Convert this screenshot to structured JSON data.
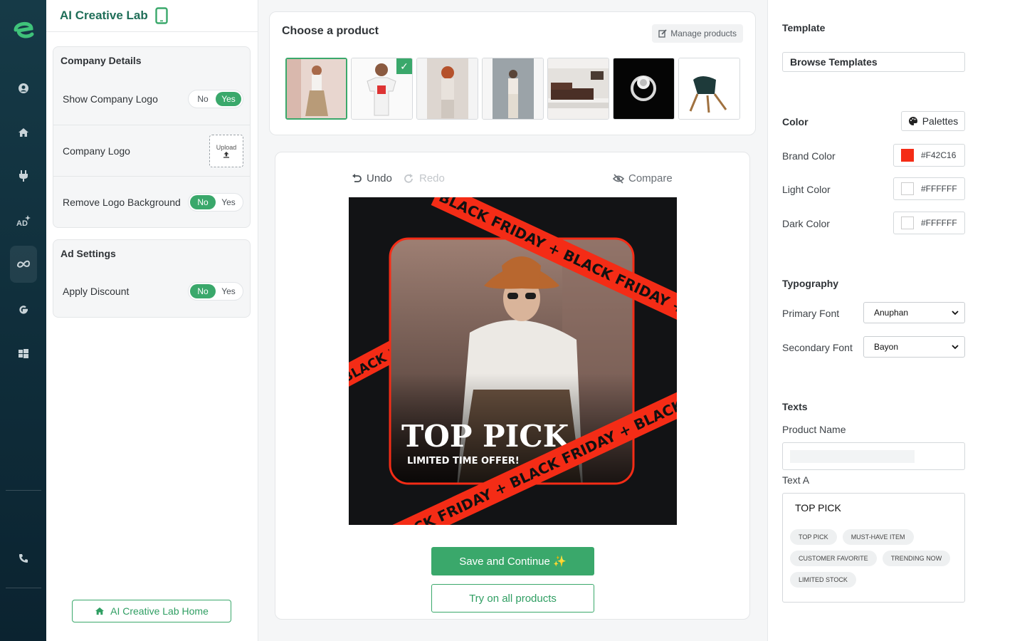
{
  "app": {
    "title": "AI Creative Lab"
  },
  "company_details": {
    "title": "Company Details",
    "show_logo": {
      "label": "Show Company Logo",
      "no": "No",
      "yes": "Yes",
      "value": "Yes"
    },
    "logo": {
      "label": "Company Logo",
      "upload": "Upload"
    },
    "remove_bg": {
      "label": "Remove Logo Background",
      "no": "No",
      "yes": "Yes",
      "value": "No"
    }
  },
  "ad_settings": {
    "title": "Ad Settings",
    "apply_discount": {
      "label": "Apply Discount",
      "no": "No",
      "yes": "Yes",
      "value": "No"
    }
  },
  "home_button": "AI Creative Lab Home",
  "products": {
    "title": "Choose a product",
    "manage": "Manage products",
    "items": [
      "woman-skirt",
      "man-tshirt",
      "woman-red-hair",
      "woman-pose",
      "sofa",
      "ring",
      "chair"
    ]
  },
  "editor": {
    "undo": "Undo",
    "redo": "Redo",
    "compare": "Compare",
    "ad": {
      "headline": "TOP PICK",
      "subline": "LIMITED TIME OFFER!",
      "banner": "BLACK FRIDAY + BLACK FRIDAY + BLACK FRIDAY + BLACK FRIDAY +"
    },
    "save": "Save and Continue ✨",
    "try_all": "Try on all products"
  },
  "template": {
    "title": "Template",
    "browse": "Browse Templates"
  },
  "color": {
    "title": "Color",
    "palettes": "Palettes",
    "brand": {
      "label": "Brand Color",
      "hex": "#F42C16"
    },
    "light": {
      "label": "Light Color",
      "hex": "#FFFFFF"
    },
    "dark": {
      "label": "Dark Color",
      "hex": "#FFFFFF"
    }
  },
  "typography": {
    "title": "Typography",
    "primary": {
      "label": "Primary Font",
      "value": "Anuphan"
    },
    "secondary": {
      "label": "Secondary Font",
      "value": "Bayon"
    }
  },
  "texts": {
    "title": "Texts",
    "product_name_label": "Product Name",
    "text_a_label": "Text A",
    "text_a_value": "TOP PICK",
    "suggestions": [
      "TOP PICK",
      "MUST-HAVE ITEM",
      "CUSTOMER FAVORITE",
      "TRENDING NOW",
      "LIMITED STOCK"
    ]
  },
  "colors": {
    "accent": "#3aa86b",
    "brand": "#F42C16",
    "rail": "#123644"
  }
}
